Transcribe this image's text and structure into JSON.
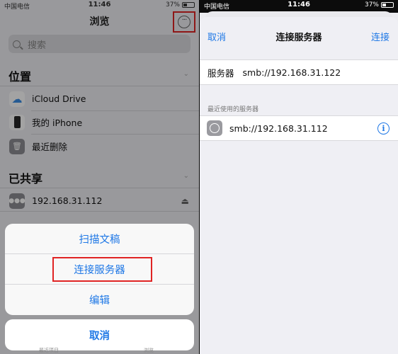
{
  "status_left": {
    "carrier": "中国电信",
    "time": "11:46",
    "battery": "37%"
  },
  "status_right": {
    "carrier": "中国电信",
    "time": "11:46",
    "battery": "37%"
  },
  "browse": {
    "title": "浏览",
    "more_icon": "ellipsis-circle-icon",
    "search_placeholder": "搜索",
    "locations_header": "位置",
    "locations": [
      {
        "label": "iCloud Drive",
        "icon": "icloud-icon"
      },
      {
        "label": "我的 iPhone",
        "icon": "iphone-icon"
      },
      {
        "label": "最近删除",
        "icon": "trash-icon"
      }
    ],
    "shared_header": "已共享",
    "shared": [
      {
        "label": "192.168.31.112",
        "icon": "server-icon",
        "action_icon": "eject-icon"
      }
    ],
    "action_sheet": [
      "扫描文稿",
      "连接服务器",
      "编辑"
    ],
    "cancel": "取消",
    "tab_ghost_left": "最近项目",
    "tab_ghost_right": "浏览"
  },
  "connect": {
    "cancel": "取消",
    "title": "连接服务器",
    "connect": "连接",
    "server_label": "服务器",
    "server_value": "smb://192.168.31.122",
    "recent_header": "最近使用的服务器",
    "recent": [
      {
        "address": "smb://192.168.31.112",
        "icon": "globe-icon",
        "action_icon": "info-icon"
      }
    ]
  },
  "colors": {
    "accent": "#1f78e6",
    "highlight": "#e02424"
  }
}
